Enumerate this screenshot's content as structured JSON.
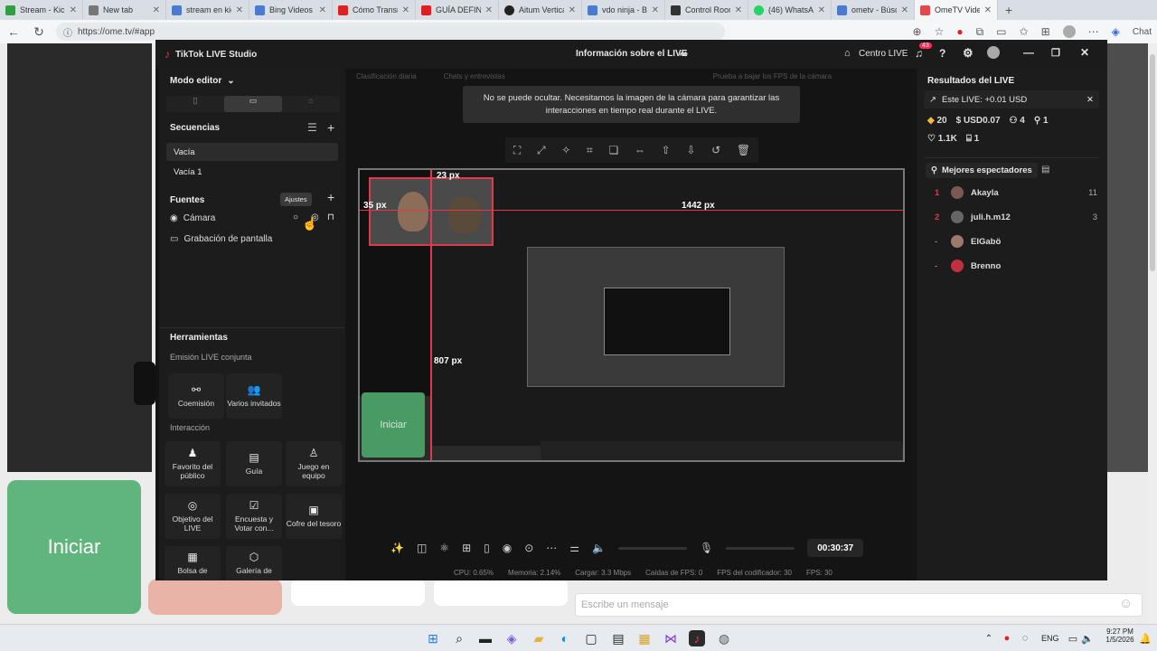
{
  "browser": {
    "tabs": [
      {
        "label": "Stream - Kick",
        "color": "#2ea043"
      },
      {
        "label": "New tab",
        "color": "#777777"
      },
      {
        "label": "stream en kick",
        "color": "#4a7bd0"
      },
      {
        "label": "Bing Videos",
        "color": "#4a7bd0"
      },
      {
        "label": "Cómo Transmitir",
        "color": "#e02020"
      },
      {
        "label": "GUÍA DEFINITIVA",
        "color": "#e02020"
      },
      {
        "label": "Aitum Vertical",
        "color": "#222222"
      },
      {
        "label": "vdo ninja - Bús",
        "color": "#4a7bd0"
      },
      {
        "label": "Control Room",
        "color": "#333333"
      },
      {
        "label": "(46) WhatsApp",
        "color": "#25d366"
      },
      {
        "label": "ometv - Búsq",
        "color": "#4a7bd0"
      },
      {
        "label": "OmeTV Video",
        "color": "#e24a4a"
      }
    ],
    "url": "https://ome.tv/#app",
    "profile_label": "Chat"
  },
  "page": {
    "start_button": "Iniciar",
    "chat_placeholder": "Escribe un mensaje"
  },
  "studio": {
    "app_title": "TikTok LIVE Studio",
    "header_title": "Información sobre el LIVE",
    "center_live": "Centro LIVE",
    "notif_count": "43",
    "mode": "Modo editor",
    "scenes_title": "Secuencias",
    "scenes": [
      "Vacía",
      "Vacía 1"
    ],
    "sources_title": "Fuentes",
    "tooltip": "Ajustes",
    "sources": [
      "Cámara",
      "Grabación de pantalla"
    ],
    "tools_title": "Herramientas",
    "joint_title": "Emisión LIVE conjunta",
    "joint_tools": [
      "Coemisión",
      "Varios invitados"
    ],
    "interaction_title": "Interacción",
    "interaction_tools": [
      "Favorito del público",
      "Guía",
      "Juego en equipo",
      "Objetivo del LIVE",
      "Encuesta y Votar con...",
      "Cofre del tesoro",
      "Bolsa de",
      "Galería de"
    ],
    "top_labels": [
      "Clasificación diaria",
      "Chats y entrevistas",
      "Prueba a bajar los FPS de la cámara"
    ],
    "toast": "No se puede ocultar. Necesitamos la imagen de la cámara para garantizar las interacciones en tiempo real durante el LIVE.",
    "dims": {
      "top": "23 px",
      "left": "35 px",
      "right": "1442 px",
      "bottom": "807 px"
    },
    "preview_start": "Iniciar",
    "timer": "00:30:37",
    "stats": [
      "CPU: 0.65%",
      "Memoria: 2.14%",
      "Cargar: 3.3 Mbps",
      "Caídas de FPS: 0",
      "FPS del codificador: 30",
      "FPS: 30"
    ]
  },
  "results": {
    "title": "Resultados del LIVE",
    "this_live": "Este LIVE: +0.01 USD",
    "diamonds": "20",
    "usd": "USD0.07",
    "viewers": "4",
    "follows": "1",
    "likes": "1.1K",
    "gifts": "1",
    "top_title": "Mejores espectadores",
    "top_viewers": [
      {
        "rank": "1",
        "name": "Akayla",
        "count": "11"
      },
      {
        "rank": "2",
        "name": "juli.h.m12",
        "count": "3"
      },
      {
        "rank": "-",
        "name": "ElGabö",
        "count": ""
      },
      {
        "rank": "-",
        "name": "Brenno",
        "count": ""
      }
    ]
  },
  "taskbar": {
    "lang": "ENG",
    "time": "9:27 PM",
    "date": "1/5/2026"
  }
}
